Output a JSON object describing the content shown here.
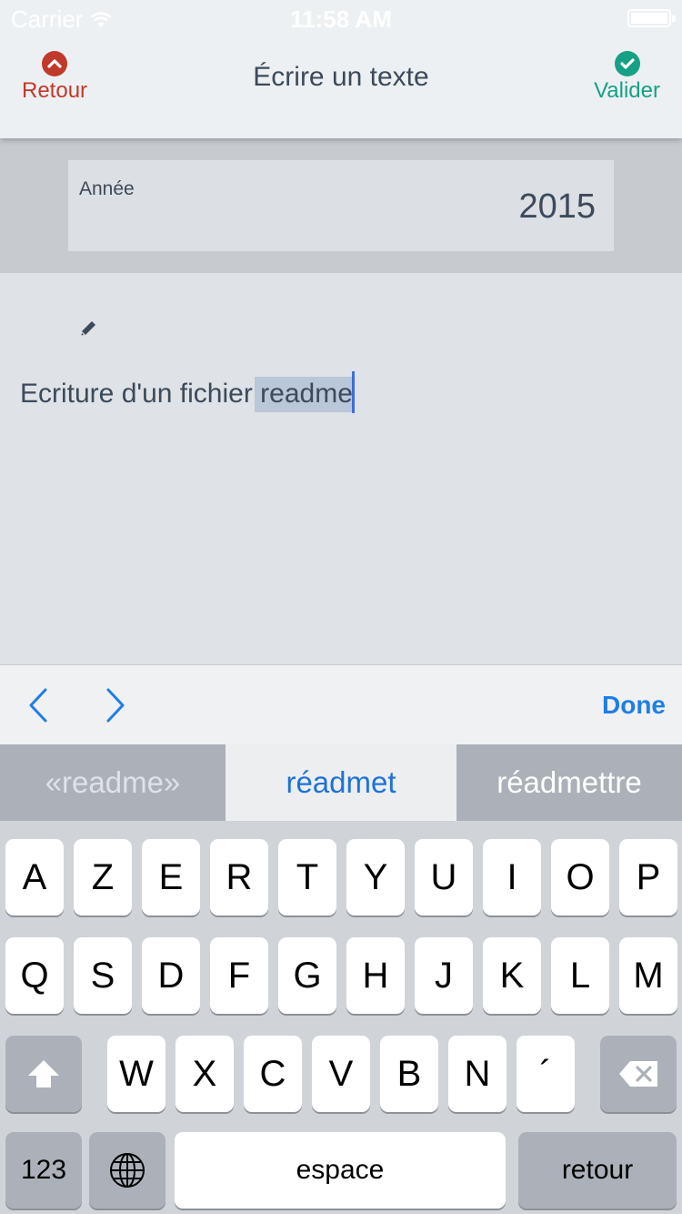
{
  "status_bar": {
    "carrier": "Carrier",
    "time": "11:58 AM"
  },
  "nav": {
    "back_label": "Retour",
    "title": "Écrire un texte",
    "ok_label": "Valider",
    "back_icon": "chevron-up-circle-icon",
    "ok_icon": "check-circle-icon"
  },
  "form": {
    "year_label": "Année",
    "year_value": "2015"
  },
  "editor": {
    "text_before": "Ecriture d'un fichier ",
    "text_selected": "readme",
    "edit_icon": "pencil-icon"
  },
  "accessory": {
    "prev_icon": "chevron-left-icon",
    "next_icon": "chevron-right-icon",
    "done_label": "Done"
  },
  "suggestions": [
    "«readme»",
    "réadmet",
    "réadmettre"
  ],
  "keyboard": {
    "row1": [
      "A",
      "Z",
      "E",
      "R",
      "T",
      "Y",
      "U",
      "I",
      "O",
      "P"
    ],
    "row2": [
      "Q",
      "S",
      "D",
      "F",
      "G",
      "H",
      "J",
      "K",
      "L",
      "M"
    ],
    "row3": [
      "W",
      "X",
      "C",
      "V",
      "B",
      "N",
      "´"
    ],
    "numbers_label": "123",
    "space_label": "espace",
    "return_label": "retour",
    "shift_icon": "shift-icon",
    "globe_icon": "globe-icon",
    "delete_icon": "backspace-icon"
  },
  "colors": {
    "back": "#c0392b",
    "ok": "#16a085",
    "accent": "#1f7ee6"
  }
}
